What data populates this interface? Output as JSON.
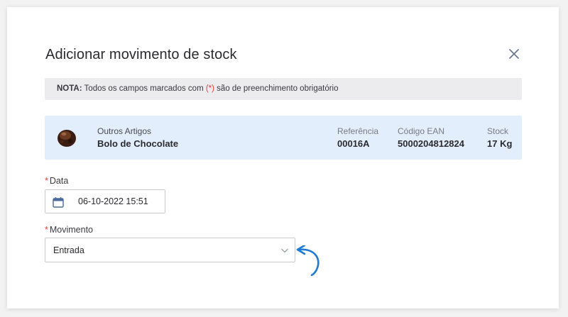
{
  "dialog": {
    "title": "Adicionar movimento de stock"
  },
  "note": {
    "label": "NOTA:",
    "text_before": " Todos os campos marcados com ",
    "required_marker": "(*)",
    "text_after": " são de preenchimento obrigatório"
  },
  "product": {
    "category": "Outros Artigos",
    "name": "Bolo de Chocolate",
    "thumbnail_icon": "chocolate-cake-icon",
    "columns": [
      {
        "label": "Referência",
        "value": "00016A"
      },
      {
        "label": "Código EAN",
        "value": "5000204812824"
      },
      {
        "label": "Stock",
        "value": "17 Kg"
      }
    ]
  },
  "form": {
    "date": {
      "required": "*",
      "label": "Data",
      "value": "06-10-2022 15:51",
      "icon": "calendar-icon"
    },
    "movement": {
      "required": "*",
      "label": "Movimento",
      "value": "Entrada",
      "icon": "chevron-down-icon"
    }
  },
  "colors": {
    "accent": "#1f7ad6",
    "required": "#e0403a",
    "product_bg": "#e3eefc",
    "note_bg": "#ececee"
  }
}
